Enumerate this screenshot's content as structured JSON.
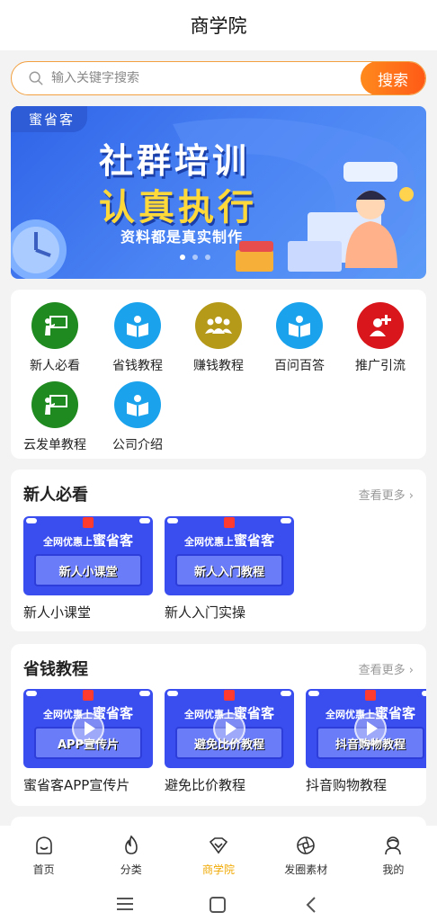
{
  "header": {
    "title": "商学院"
  },
  "search": {
    "placeholder": "输入关键字搜索",
    "button_label": "搜索"
  },
  "banner": {
    "tag": "蜜省客",
    "line1": "社群培训",
    "line2": "认真执行",
    "line3": "资料都是真实制作",
    "dots": 3,
    "active_dot": 0
  },
  "categories": [
    {
      "label": "新人必看",
      "icon": "teacher-board-icon",
      "color": "#1f8a1f"
    },
    {
      "label": "省钱教程",
      "icon": "open-book-icon",
      "color": "#1aa3ec"
    },
    {
      "label": "赚钱教程",
      "icon": "group-people-icon",
      "color": "#b59a1a"
    },
    {
      "label": "百问百答",
      "icon": "open-book-icon",
      "color": "#1aa3ec"
    },
    {
      "label": "推广引流",
      "icon": "add-user-icon",
      "color": "#d8161b"
    },
    {
      "label": "云发单教程",
      "icon": "teacher-board-icon",
      "color": "#1f8a1f"
    },
    {
      "label": "公司介绍",
      "icon": "open-book-icon",
      "color": "#1aa3ec"
    }
  ],
  "sections": [
    {
      "title": "新人必看",
      "more": "查看更多 ›",
      "items": [
        {
          "thumb_top": "全网优惠上",
          "thumb_brand": "蜜省客",
          "thumb_panel": "新人小课堂",
          "label": "新人小课堂",
          "play": false
        },
        {
          "thumb_top": "全网优惠上",
          "thumb_brand": "蜜省客",
          "thumb_panel": "新人入门教程",
          "label": "新人入门实操",
          "play": false
        }
      ]
    },
    {
      "title": "省钱教程",
      "more": "查看更多 ›",
      "items": [
        {
          "thumb_top": "全网优惠上",
          "thumb_brand": "蜜省客",
          "thumb_panel": "APP宣传片",
          "label": "蜜省客APP宣传片",
          "play": true
        },
        {
          "thumb_top": "全网优惠上",
          "thumb_brand": "蜜省客",
          "thumb_panel": "避免比价教程",
          "label": "避免比价教程",
          "play": true
        },
        {
          "thumb_top": "全网优惠上",
          "thumb_brand": "蜜省客",
          "thumb_panel": "抖音购物教程",
          "label": "抖音购物教程",
          "play": true
        }
      ]
    }
  ],
  "tabbar": [
    {
      "label": "首页",
      "icon": "home-face-icon",
      "active": false
    },
    {
      "label": "分类",
      "icon": "flame-icon",
      "active": false
    },
    {
      "label": "商学院",
      "icon": "diamond-icon",
      "active": true
    },
    {
      "label": "发圈素材",
      "icon": "aperture-icon",
      "active": false
    },
    {
      "label": "我的",
      "icon": "user-profile-icon",
      "active": false
    }
  ],
  "colors": {
    "accent": "#f0a800",
    "search_btn": "#ff6a1a",
    "banner_bg": "#3b6ff0"
  }
}
